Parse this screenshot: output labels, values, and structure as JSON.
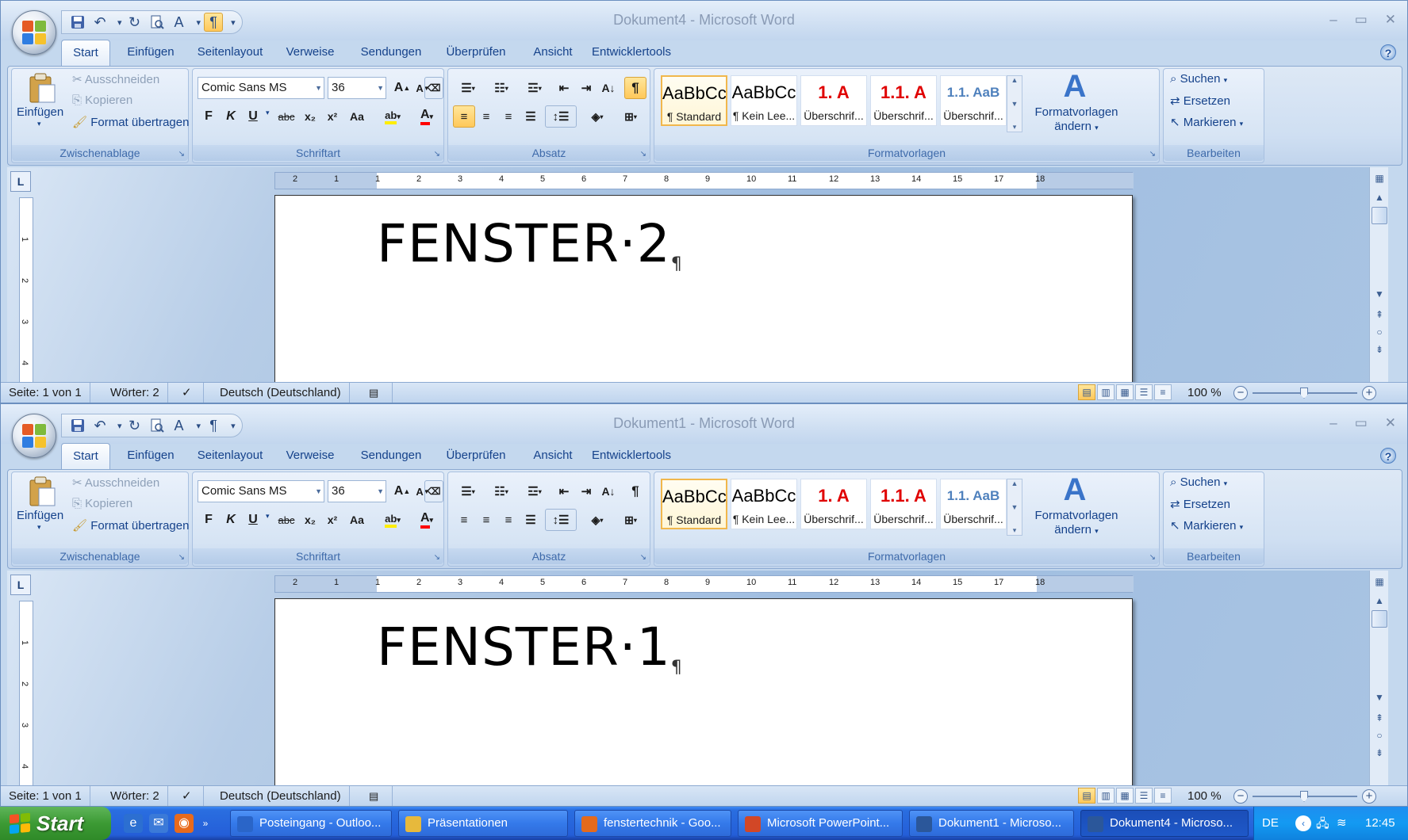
{
  "windows": [
    {
      "id": "A",
      "title": "Dokument4 - Microsoft Word",
      "doc_text": "FENSTER·2",
      "show_marks_active": true,
      "align_left_active": true
    },
    {
      "id": "B",
      "title": "Dokument1 - Microsoft Word",
      "doc_text": "FENSTER·1",
      "show_marks_active": false,
      "align_left_active": false
    }
  ],
  "ribbon": {
    "tabs": [
      "Start",
      "Einfügen",
      "Seitenlayout",
      "Verweise",
      "Sendungen",
      "Überprüfen",
      "Ansicht",
      "Entwicklertools"
    ],
    "clipboard": {
      "label": "Zwischenablage",
      "paste": "Einfügen",
      "cut": "Ausschneiden",
      "copy": "Kopieren",
      "format_painter": "Format übertragen"
    },
    "font": {
      "label": "Schriftart",
      "font_name": "Comic Sans MS",
      "font_size": "36",
      "bold": "F",
      "italic": "K",
      "underline": "U",
      "strike": "abc",
      "subscript": "x₂",
      "superscript": "x²",
      "case": "Aa"
    },
    "paragraph": {
      "label": "Absatz"
    },
    "styles": {
      "label": "Formatvorlagen",
      "items": [
        {
          "sample": "AaBbCc",
          "name": "¶ Standard",
          "color": "#000000"
        },
        {
          "sample": "AaBbCc",
          "name": "¶ Kein Lee...",
          "color": "#000000"
        },
        {
          "sample": "1.  A",
          "name": "Überschrif...",
          "color": "#e00000"
        },
        {
          "sample": "1.1.  A",
          "name": "Überschrif...",
          "color": "#e00000"
        },
        {
          "sample": "1.1.  AaB",
          "name": "Überschrif...",
          "color": "#4f81bd"
        }
      ],
      "change_styles_line1": "Formatvorlagen",
      "change_styles_line2": "ändern"
    },
    "editing": {
      "label": "Bearbeiten",
      "find": "Suchen",
      "replace": "Ersetzen",
      "select": "Markieren"
    }
  },
  "ruler": {
    "ticks": [
      "2",
      "1",
      "1",
      "2",
      "3",
      "4",
      "5",
      "6",
      "7",
      "8",
      "9",
      "10",
      "11",
      "12",
      "13",
      "14",
      "15",
      "17",
      "18"
    ],
    "vticks": [
      "1",
      "2",
      "3",
      "4"
    ]
  },
  "statusbar": {
    "page": "Seite: 1 von 1",
    "words": "Wörter: 2",
    "language": "Deutsch (Deutschland)",
    "zoom": "100 %"
  },
  "taskbar": {
    "start": "Start",
    "tasks": [
      {
        "label": "Posteingang - Outloo...",
        "icon_color": "#2a65c8"
      },
      {
        "label": "Präsentationen",
        "icon_color": "#e7b93c"
      },
      {
        "label": "fenstertechnik - Goo...",
        "icon_color": "#e46a1c"
      },
      {
        "label": "Microsoft PowerPoint...",
        "icon_color": "#d24726"
      },
      {
        "label": "Dokument1 - Microso...",
        "icon_color": "#2b579a"
      },
      {
        "label": "Dokument4 - Microso...",
        "icon_color": "#2b579a"
      }
    ],
    "lang": "DE",
    "clock": "12:45"
  },
  "colors": {
    "accent": "#15428b",
    "highlight": "#ffc85a"
  }
}
